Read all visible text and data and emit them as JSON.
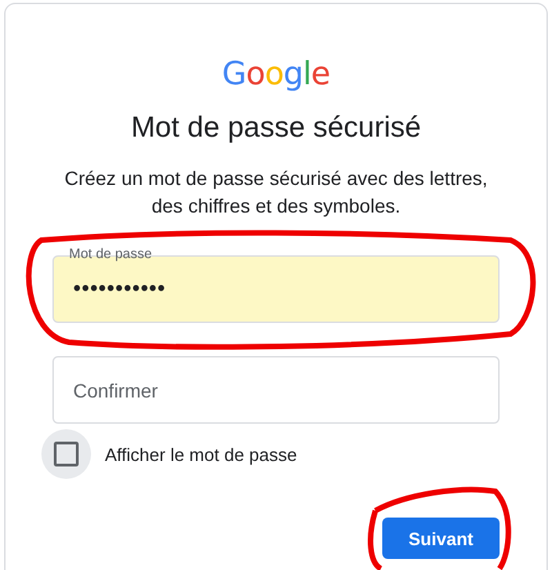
{
  "logo": "Google",
  "title": "Mot de passe sécurisé",
  "subtitle": "Créez un mot de passe sécurisé avec des lettres, des chiffres et des symboles.",
  "fields": [
    {
      "label": "Mot de passe",
      "value": "•••••••••••",
      "autofilled": true
    },
    {
      "placeholder": "Confirmer",
      "autofilled": false
    }
  ],
  "show_password": {
    "label": "Afficher le mot de passe",
    "checked": false
  },
  "buttons": [
    {
      "label": "Suivant"
    }
  ]
}
